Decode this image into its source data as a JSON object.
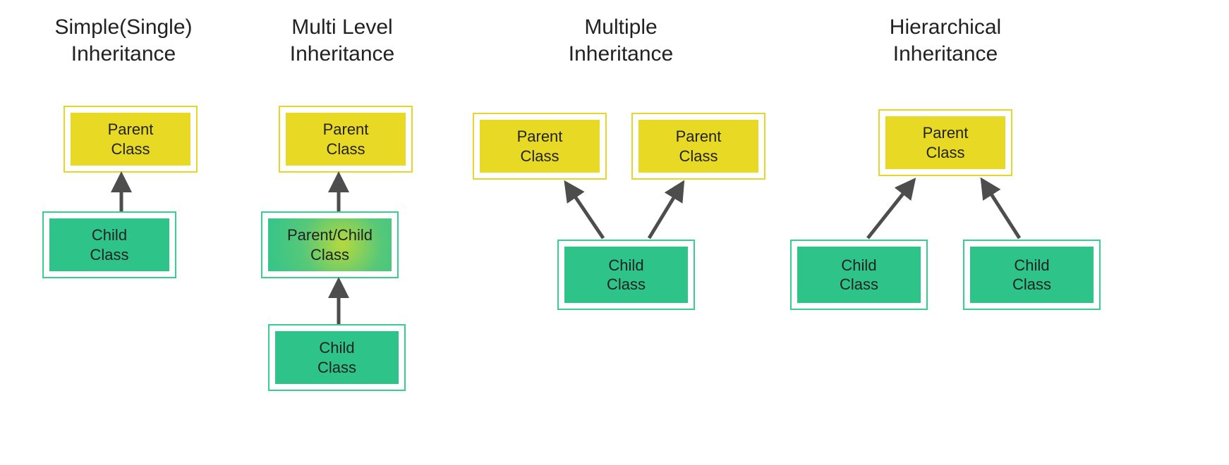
{
  "colors": {
    "parent_fill": "#e8da24",
    "parent_border": "#e6d52a",
    "child_fill": "#2dc389",
    "child_border": "#36cf8f",
    "arrow": "#4d4d4d",
    "text": "#222222",
    "background": "#ffffff"
  },
  "diagrams": [
    {
      "key": "single",
      "title": "Simple(Single)\nInheritance",
      "nodes": [
        {
          "role": "parent",
          "label": "Parent\nClass"
        },
        {
          "role": "child",
          "label": "Child\nClass"
        }
      ],
      "edges": [
        {
          "from": "child",
          "to": "parent"
        }
      ]
    },
    {
      "key": "multilevel",
      "title": "Multi Level\nInheritance",
      "nodes": [
        {
          "role": "parent",
          "label": "Parent\nClass"
        },
        {
          "role": "parent-child",
          "label": "Parent/Child\nClass"
        },
        {
          "role": "child",
          "label": "Child\nClass"
        }
      ],
      "edges": [
        {
          "from": "parent-child",
          "to": "parent"
        },
        {
          "from": "child",
          "to": "parent-child"
        }
      ]
    },
    {
      "key": "multiple",
      "title": "Multiple\nInheritance",
      "nodes": [
        {
          "role": "parent-a",
          "label": "Parent\nClass"
        },
        {
          "role": "parent-b",
          "label": "Parent\nClass"
        },
        {
          "role": "child",
          "label": "Child\nClass"
        }
      ],
      "edges": [
        {
          "from": "child",
          "to": "parent-a"
        },
        {
          "from": "child",
          "to": "parent-b"
        }
      ]
    },
    {
      "key": "hierarchical",
      "title": "Hierarchical\nInheritance",
      "nodes": [
        {
          "role": "parent",
          "label": "Parent\nClass"
        },
        {
          "role": "child-a",
          "label": "Child\nClass"
        },
        {
          "role": "child-b",
          "label": "Child\nClass"
        }
      ],
      "edges": [
        {
          "from": "child-a",
          "to": "parent"
        },
        {
          "from": "child-b",
          "to": "parent"
        }
      ]
    }
  ]
}
